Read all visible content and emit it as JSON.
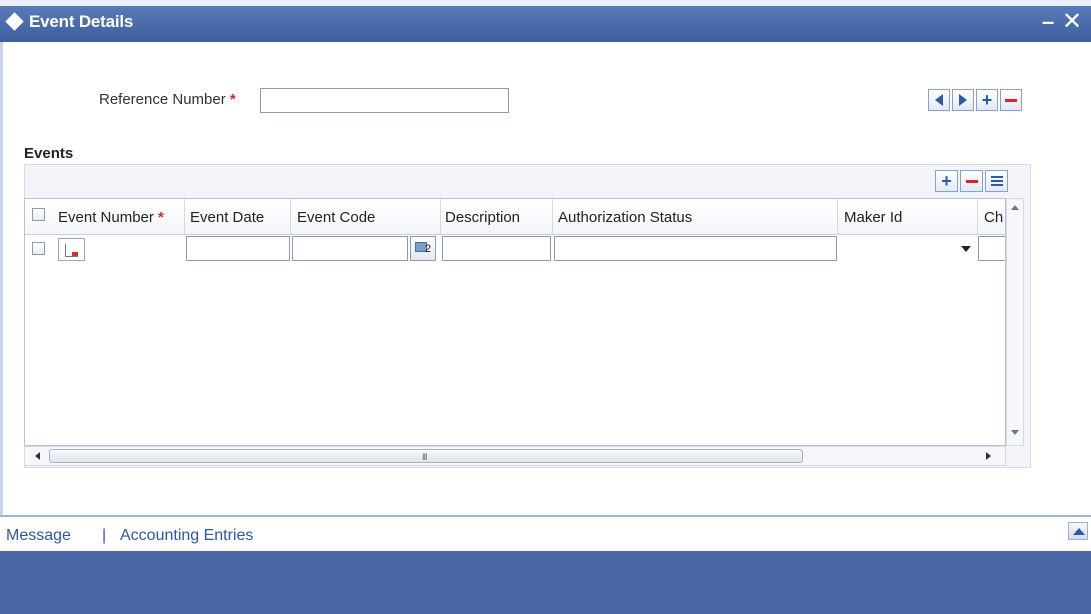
{
  "window": {
    "title": "Event Details",
    "minimize_label": "–",
    "close_label": "✕"
  },
  "form": {
    "reference_number_label": "Reference Number",
    "required_mark": "*",
    "reference_number_value": ""
  },
  "events": {
    "heading": "Events",
    "columns": [
      "Event Number",
      "Event Date",
      "Event Code",
      "Description",
      "Authorization Status",
      "Maker Id",
      "Ch"
    ],
    "rows": [
      {
        "event_number": "",
        "event_date": "",
        "event_code": "",
        "description": "",
        "authorization_status": "",
        "maker_id": "",
        "checker": ""
      }
    ],
    "hscroll_grip": "III"
  },
  "footer": {
    "link_message": "Message",
    "separator": "|",
    "link_accounting": "Accounting Entries"
  },
  "colors": {
    "titlebar": "#3d5e9f",
    "accent_blue": "#2d5aa8",
    "required_red": "#dd2222",
    "link_blue": "#2e57a8",
    "footer_panel": "#4a67a6"
  }
}
